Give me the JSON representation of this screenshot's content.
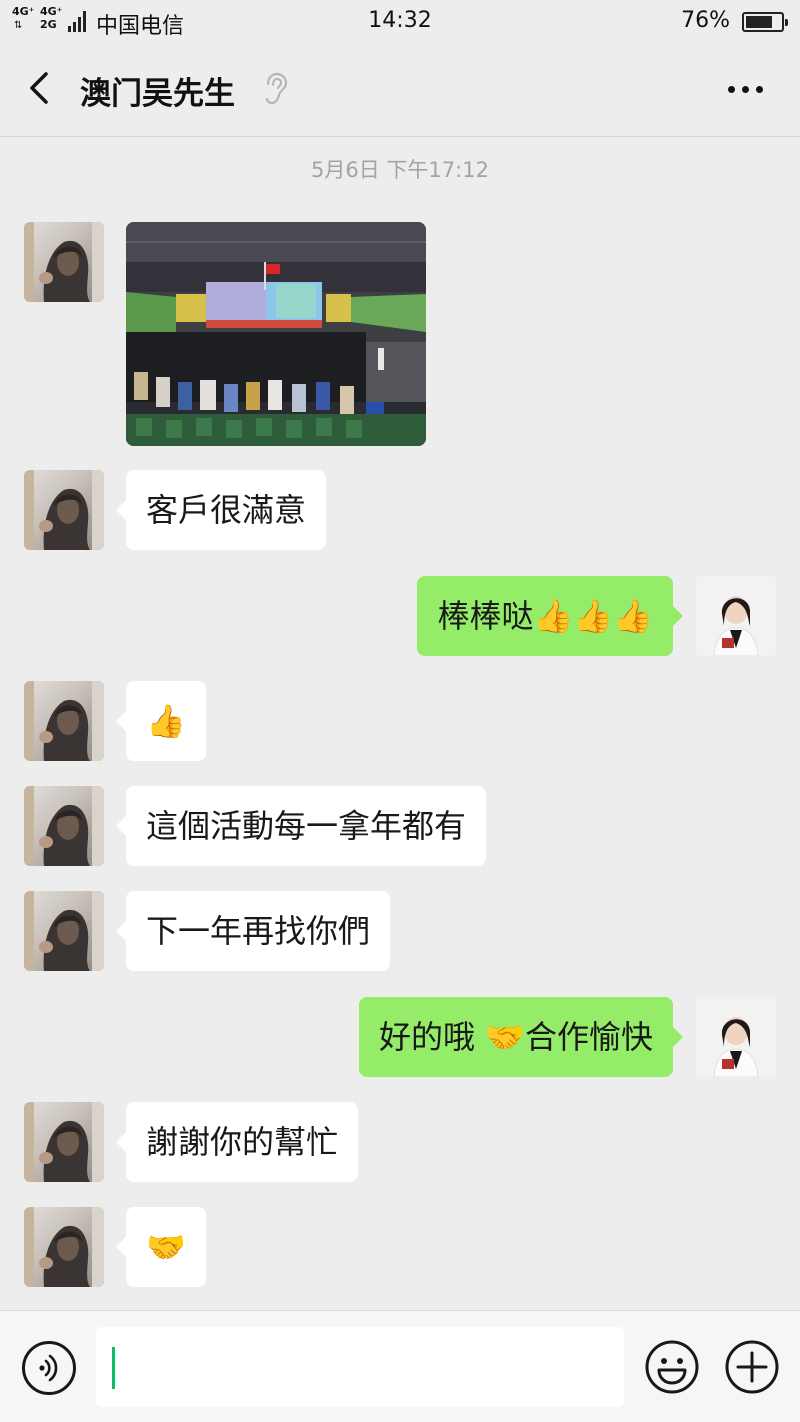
{
  "status_bar": {
    "network_1": "4G⁺",
    "network_2": "4G⁺",
    "network_3": "2G",
    "carrier": "中国电信",
    "time": "14:32",
    "battery": "76%",
    "battery_level": 0.76
  },
  "header": {
    "back_icon": "chevron-left-icon",
    "title": "澳门吴先生",
    "ear_icon": "earpiece-mode-icon",
    "more_icon": "more-dots-icon"
  },
  "chat": {
    "timestamp": "5月6日 下午17:12",
    "messages": [
      {
        "sender": "contact",
        "kind": "image"
      },
      {
        "sender": "contact",
        "text": "客戶很滿意"
      },
      {
        "sender": "me",
        "text": "棒棒哒👍👍👍"
      },
      {
        "sender": "contact",
        "text": "👍"
      },
      {
        "sender": "contact",
        "text": "這個活動每一拿年都有"
      },
      {
        "sender": "contact",
        "text": "下一年再找你們"
      },
      {
        "sender": "me",
        "text": "好的哦 🤝合作愉快"
      },
      {
        "sender": "contact",
        "text": "謝謝你的幫忙"
      },
      {
        "sender": "contact",
        "text": "🤝"
      }
    ]
  },
  "input_bar": {
    "voice_icon": "voice-input-icon",
    "input_value": "",
    "emoji_icon": "emoji-icon",
    "plus_icon": "plus-icon"
  }
}
